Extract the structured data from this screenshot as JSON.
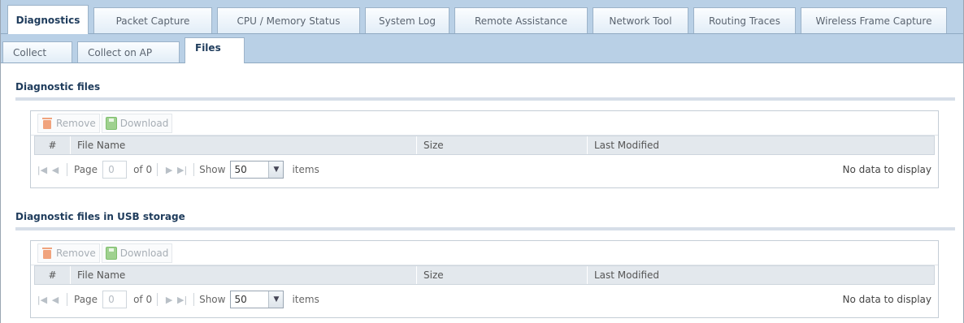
{
  "main_tabs": [
    {
      "label": "Diagnostics",
      "active": true
    },
    {
      "label": "Packet Capture",
      "active": false
    },
    {
      "label": "CPU / Memory Status",
      "active": false
    },
    {
      "label": "System Log",
      "active": false
    },
    {
      "label": "Remote Assistance",
      "active": false
    },
    {
      "label": "Network Tool",
      "active": false
    },
    {
      "label": "Routing Traces",
      "active": false
    },
    {
      "label": "Wireless Frame Capture",
      "active": false
    }
  ],
  "sub_tabs": [
    {
      "label": "Collect",
      "active": false
    },
    {
      "label": "Collect on AP",
      "active": false
    },
    {
      "label": "Files",
      "active": true
    }
  ],
  "sections": [
    {
      "title": "Diagnostic files",
      "toolbar": {
        "remove": "Remove",
        "download": "Download"
      },
      "columns": {
        "num": "#",
        "name": "File Name",
        "size": "Size",
        "modified": "Last Modified"
      },
      "pager": {
        "page_label": "Page",
        "page_value": "0",
        "of_label": "of 0",
        "show_label": "Show",
        "show_value": "50",
        "items_label": "items",
        "status": "No data to display"
      }
    },
    {
      "title": "Diagnostic files in USB storage",
      "toolbar": {
        "remove": "Remove",
        "download": "Download"
      },
      "columns": {
        "num": "#",
        "name": "File Name",
        "size": "Size",
        "modified": "Last Modified"
      },
      "pager": {
        "page_label": "Page",
        "page_value": "0",
        "of_label": "of 0",
        "show_label": "Show",
        "show_value": "50",
        "items_label": "items",
        "status": "No data to display"
      }
    }
  ],
  "colors": {
    "tab_bar": "#b9d0e6",
    "title_text": "#1f3c5c",
    "header_bg": "#e3e8ed"
  },
  "icons": {
    "remove": "trash-icon",
    "download": "disk-icon",
    "first": "first-page-icon",
    "prev": "prev-page-icon",
    "next": "next-page-icon",
    "last": "last-page-icon",
    "dropdown": "chevron-down-icon"
  }
}
